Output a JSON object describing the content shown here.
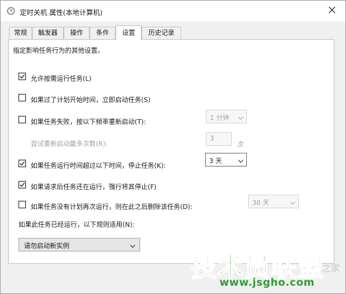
{
  "window": {
    "title": "定时关机 属性(本地计算机)",
    "close_icon": "close-icon"
  },
  "tabs": [
    {
      "label": "常规"
    },
    {
      "label": "触发器"
    },
    {
      "label": "操作"
    },
    {
      "label": "条件"
    },
    {
      "label": "设置"
    },
    {
      "label": "历史记录"
    }
  ],
  "active_tab": "设置",
  "settings": {
    "description": "指定影响任务行为的其他设置。",
    "allow_on_demand": {
      "label": "允许按需运行任务(L)",
      "checked": true
    },
    "run_if_missed": {
      "label": "如果过了计划开始时间，立即启动任务(S)",
      "checked": false
    },
    "restart_on_failure": {
      "label": "如果任务失败，按以下频率重新启动(T):",
      "checked": false,
      "interval_value": "1 分钟"
    },
    "restart_attempts": {
      "label": "尝试重新启动最多次数(R):",
      "value": "3",
      "unit": "次"
    },
    "stop_if_longer": {
      "label": "如果任务运行时间超过以下时间，停止任务(K):",
      "checked": true,
      "duration_value": "3 天"
    },
    "force_stop": {
      "label": "如果请求后任务还在运行，强行将其停止(F)",
      "checked": true
    },
    "delete_if_not_scheduled": {
      "label": "如果任务没有计划再次运行，则在此之后删除该任务(D):",
      "checked": false,
      "delete_after_value": "30 天"
    },
    "already_running_label": "如果此任务已经运行，以下规则适用(N):",
    "already_running_value": "请勿启动新实例"
  },
  "watermark": {
    "text": "技术员联盟",
    "url": "www.jsgho.com",
    "suffix": "之家"
  },
  "colors": {
    "watermark_green": "#2f9b36",
    "panel_bg": "#ffffff",
    "window_bg": "#f0f0f0"
  }
}
